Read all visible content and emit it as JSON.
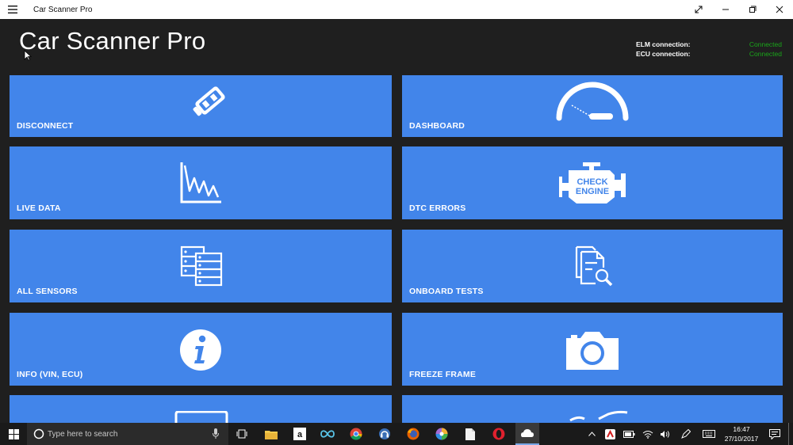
{
  "window": {
    "title": "Car Scanner Pro"
  },
  "header": {
    "app_title": "Car Scanner Pro",
    "elm_label": "ELM connection:",
    "ecu_label": "ECU connection:",
    "elm_status": "Connected",
    "ecu_status": "Connected",
    "status_color": "#1aa61a"
  },
  "tiles": [
    {
      "label": "DISCONNECT",
      "icon": "obd-plug-icon"
    },
    {
      "label": "DASHBOARD",
      "icon": "speedometer-icon"
    },
    {
      "label": "LIVE DATA",
      "icon": "graph-icon"
    },
    {
      "label": "DTC ERRORS",
      "icon": "check-engine-icon"
    },
    {
      "label": "ALL SENSORS",
      "icon": "sensors-list-icon"
    },
    {
      "label": "ONBOARD TESTS",
      "icon": "document-search-icon"
    },
    {
      "label": "INFO (VIN, ECU)",
      "icon": "info-icon"
    },
    {
      "label": "FREEZE FRAME",
      "icon": "camera-icon"
    }
  ],
  "check_engine_text": [
    "CHECK",
    "ENGINE"
  ],
  "tile_color": "#4285ea",
  "taskbar": {
    "search_placeholder": "Type here to search",
    "time": "16:47",
    "date": "27/10/2017"
  }
}
